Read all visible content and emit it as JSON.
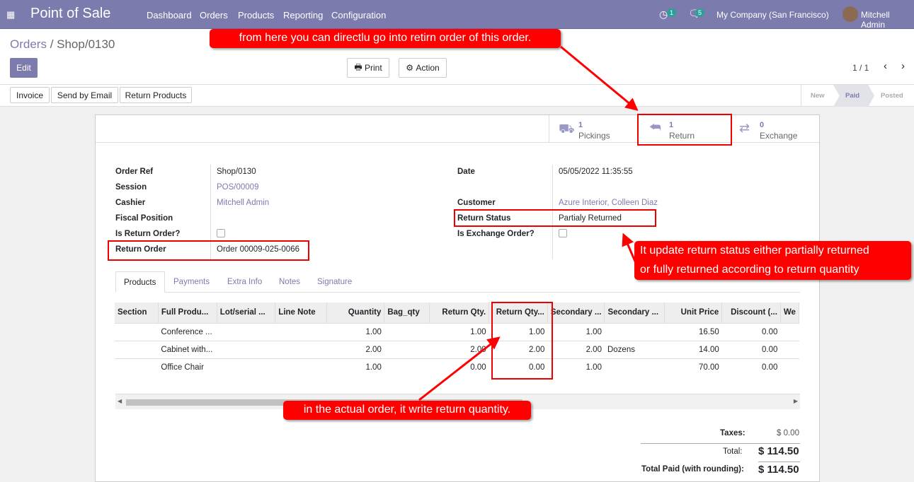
{
  "nav": {
    "app": "Point of Sale",
    "menu": [
      "Dashboard",
      "Orders",
      "Products",
      "Reporting",
      "Configuration"
    ],
    "activity_count": "1",
    "message_count": "5",
    "company": "My Company (San Francisco)",
    "user": "Mitchell Admin"
  },
  "breadcrumb": {
    "parent": "Orders",
    "current": "Shop/0130"
  },
  "buttons": {
    "edit": "Edit",
    "print": "Print",
    "action": "Action",
    "invoice": "Invoice",
    "send_email": "Send by Email",
    "return_products": "Return Products"
  },
  "pager": "1 / 1",
  "status": [
    "New",
    "Paid",
    "Posted"
  ],
  "status_active": "Paid",
  "smart": [
    {
      "count": "1",
      "label": "Pickings",
      "icon": "truck-icon"
    },
    {
      "count": "1",
      "label": "Return",
      "icon": "reply-all-icon"
    },
    {
      "count": "0",
      "label": "Exchange",
      "icon": "exchange-icon"
    }
  ],
  "fields": {
    "order_ref_l": "Order Ref",
    "order_ref": "Shop/0130",
    "session_l": "Session",
    "session": "POS/00009",
    "cashier_l": "Cashier",
    "cashier": "Mitchell Admin",
    "fiscal_l": "Fiscal Position",
    "is_return_l": "Is Return Order?",
    "return_order_l": "Return Order",
    "return_order": "Order 00009-025-0066",
    "date_l": "Date",
    "date": "05/05/2022 11:35:55",
    "customer_l": "Customer",
    "customer": "Azure Interior, Colleen Diaz",
    "return_status_l": "Return Status",
    "return_status": "Partialy Returned",
    "is_exchange_l": "Is Exchange Order?"
  },
  "tabs": [
    "Products",
    "Payments",
    "Extra Info",
    "Notes",
    "Signature"
  ],
  "table": {
    "headers": [
      "Section",
      "Full Produ...",
      "Lot/serial ...",
      "Line Note",
      "Quantity",
      "Bag_qty",
      "Return Qty.",
      "Return Qty...",
      "Secondary ...",
      "Secondary ...",
      "Unit Price",
      "Discount (...",
      "We"
    ],
    "rows": [
      [
        "",
        "Conference ...",
        "",
        "",
        "1.00",
        "",
        "1.00",
        "1.00",
        "1.00",
        "",
        "16.50",
        "0.00",
        ""
      ],
      [
        "",
        "Cabinet with...",
        "",
        "",
        "2.00",
        "",
        "2.00",
        "2.00",
        "2.00",
        "Dozens",
        "14.00",
        "0.00",
        ""
      ],
      [
        "",
        "Office Chair",
        "",
        "",
        "1.00",
        "",
        "0.00",
        "0.00",
        "1.00",
        "",
        "70.00",
        "0.00",
        ""
      ]
    ]
  },
  "totals": {
    "taxes_l": "Taxes:",
    "taxes": "$ 0.00",
    "total_l": "Total:",
    "total": "$ 114.50",
    "paid_l": "Total Paid (with rounding):",
    "paid": "$ 114.50"
  },
  "annotations": {
    "a1": "from here you can directlu go into retirn order of this order.",
    "a2_1": "It update return status either partially returned",
    "a2_2": "or fully returned according to return quantity",
    "a3": "in the actual order, it write return quantity."
  },
  "colors": {
    "brand": "#7c7bad",
    "annotation": "#ff0000"
  }
}
